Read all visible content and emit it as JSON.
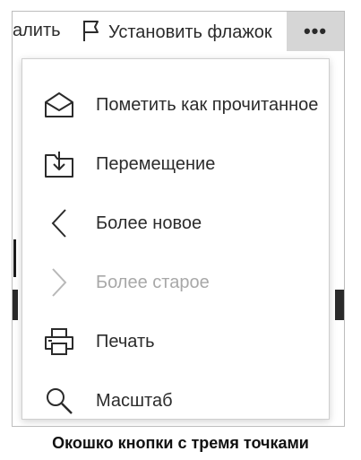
{
  "toolbar": {
    "delete_label_partial": "алить",
    "flag_label": "Установить флажок",
    "more_label": "•••"
  },
  "menu": {
    "items": [
      {
        "label": "Пометить как прочитанное",
        "icon": "envelope-open-icon",
        "enabled": true
      },
      {
        "label": "Перемещение",
        "icon": "move-to-folder-icon",
        "enabled": true
      },
      {
        "label": "Более новое",
        "icon": "chevron-left-icon",
        "enabled": true
      },
      {
        "label": "Более старое",
        "icon": "chevron-right-icon",
        "enabled": false
      },
      {
        "label": "Печать",
        "icon": "printer-icon",
        "enabled": true
      },
      {
        "label": "Масштаб",
        "icon": "magnifier-icon",
        "enabled": true
      }
    ]
  },
  "caption": "Окошко кнопки с тремя точками",
  "colors": {
    "text": "#2b2b2b",
    "disabled_text": "#a8a8a8",
    "more_button_bg": "#d6d6d6"
  }
}
